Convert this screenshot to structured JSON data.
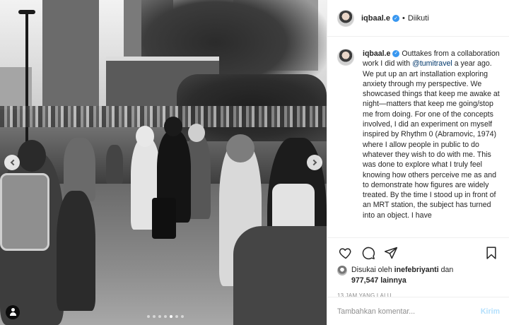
{
  "post": {
    "carousel": {
      "slide_count": 7,
      "active_slide": 5
    }
  },
  "header": {
    "username": "iqbaal.e",
    "verified_icon": "verified-badge-icon",
    "separator": "•",
    "follow_status": "Diikuti"
  },
  "caption": {
    "username": "iqbaal.e",
    "text_before_mention": " Outtakes from a collaboration work I did with ",
    "mention": "@tumitravel",
    "text_after_mention": " a year ago. We put up an art installation exploring anxiety through my perspective. We showcased things that keep me awake at night—matters that keep me going/stop me from doing. For one of the concepts involved, I did an experiment on myself inspired by Rhythm 0 (Abramovic, 1974) where I allow people in public to do whatever they wish to do with me. This was done to explore what I truly feel knowing how others perceive me as and to demonstrate how figures are widely treated. By the time I stood up in front of an MRT station, the subject has turned into an object. I have"
  },
  "actions": {
    "icons": [
      "heart-icon",
      "comment-icon",
      "share-icon",
      "bookmark-icon"
    ]
  },
  "likes": {
    "prefix": "Disukai oleh ",
    "user": "inefebriyanti",
    "middle": " dan",
    "count": "977,547",
    "suffix": " lainnya"
  },
  "timestamp": "13 JAM YANG LALU",
  "comment": {
    "placeholder": "Tambahkan komentar...",
    "post_label": "Kirim"
  },
  "colors": {
    "verified": "#3897f0",
    "mention": "#00376b",
    "post_disabled": "#b2dffc",
    "muted": "#8e8e8e"
  }
}
